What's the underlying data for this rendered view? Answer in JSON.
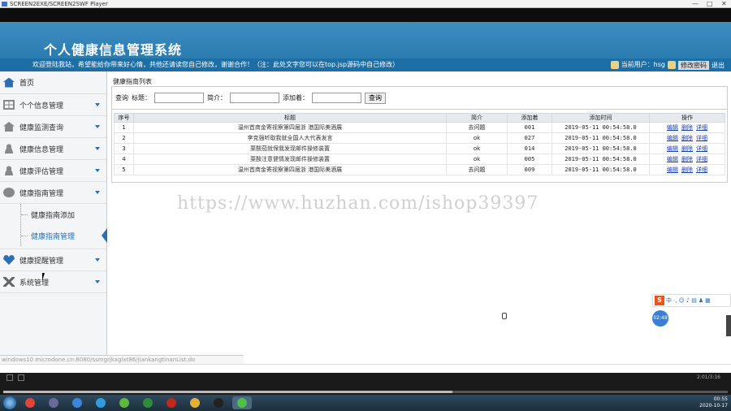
{
  "player": {
    "title": "SCREEN2EXE/SCREEN2SWF Player",
    "time_display": "2:01/3:16"
  },
  "header": {
    "site_title": "个人健康信息管理系统",
    "welcome": "欢迎登陆我站，希望能给你带来好心情，共他还请读您自己修改，谢谢合作！（注：此处文字您可以在top.jsp源码中自己修改）",
    "current_user_label": "当前用户：hsg",
    "change_password": "修改密码",
    "logout": "退出"
  },
  "sidebar": {
    "home": "首页",
    "items": [
      {
        "label": "个个信息管理",
        "icon": "grid-icon"
      },
      {
        "label": "健康监测查询",
        "icon": "house-icon"
      },
      {
        "label": "健康信息管理",
        "icon": "person-icon"
      },
      {
        "label": "健康评估管理",
        "icon": "user-icon"
      },
      {
        "label": "健康指南管理",
        "icon": "chat-icon"
      }
    ],
    "sub_items": [
      "健康指南添加",
      "健康指南管理"
    ],
    "items_after": [
      {
        "label": "健康提醒管理",
        "icon": "heart-icon"
      },
      {
        "label": "系统管理",
        "icon": "tools-icon"
      }
    ]
  },
  "main": {
    "panel_title": "健康指南列表",
    "search": {
      "label_query": "查询",
      "label_title": "标题：",
      "label_intro": "简介：",
      "label_adder": "添加着：",
      "button": "查询"
    },
    "columns": [
      "序号",
      "标题",
      "简介",
      "添加着",
      "添加时间",
      "操作"
    ],
    "rows": [
      {
        "no": "1",
        "title": "温州首商金寄视察第四届浙 港国际美酒展",
        "intro": "去问题",
        "adder": "001",
        "time": "2019-05-11 00:54:58.0"
      },
      {
        "no": "2",
        "title": "李克强听取我就全国人大代表发言",
        "intro": "ok",
        "adder": "027",
        "time": "2019-05-11 00:54:58.0"
      },
      {
        "no": "3",
        "title": "栗酸茄就保我发现邮件操修装置",
        "intro": "ok",
        "adder": "014",
        "time": "2019-05-11 00:54:58.0"
      },
      {
        "no": "4",
        "title": "栗酸注意健情发现邮件操修装置",
        "intro": "ok",
        "adder": "005",
        "time": "2019-05-11 00:54:58.0"
      },
      {
        "no": "5",
        "title": "温州首商金寄视察第四届浙 港国际美酒展",
        "intro": "去问题",
        "adder": "009",
        "time": "2019-05-11 00:54:58.0"
      }
    ],
    "actions": [
      "编辑",
      "删除",
      "详细"
    ]
  },
  "watermark": "https://www.huzhan.com/ishop39397",
  "ime_bubble": "02:48",
  "status_url": "windows10.microdone.cn:8080/ssmgrjkxglxt86/jiankangtinanList.do",
  "tray": {
    "time": "00:55",
    "date": "2020-10-17"
  },
  "colors": {
    "header": "#2a7bb0",
    "subbar": "#1d6ea4",
    "accent": "#2a6fb3",
    "link": "#1a3fb0"
  }
}
